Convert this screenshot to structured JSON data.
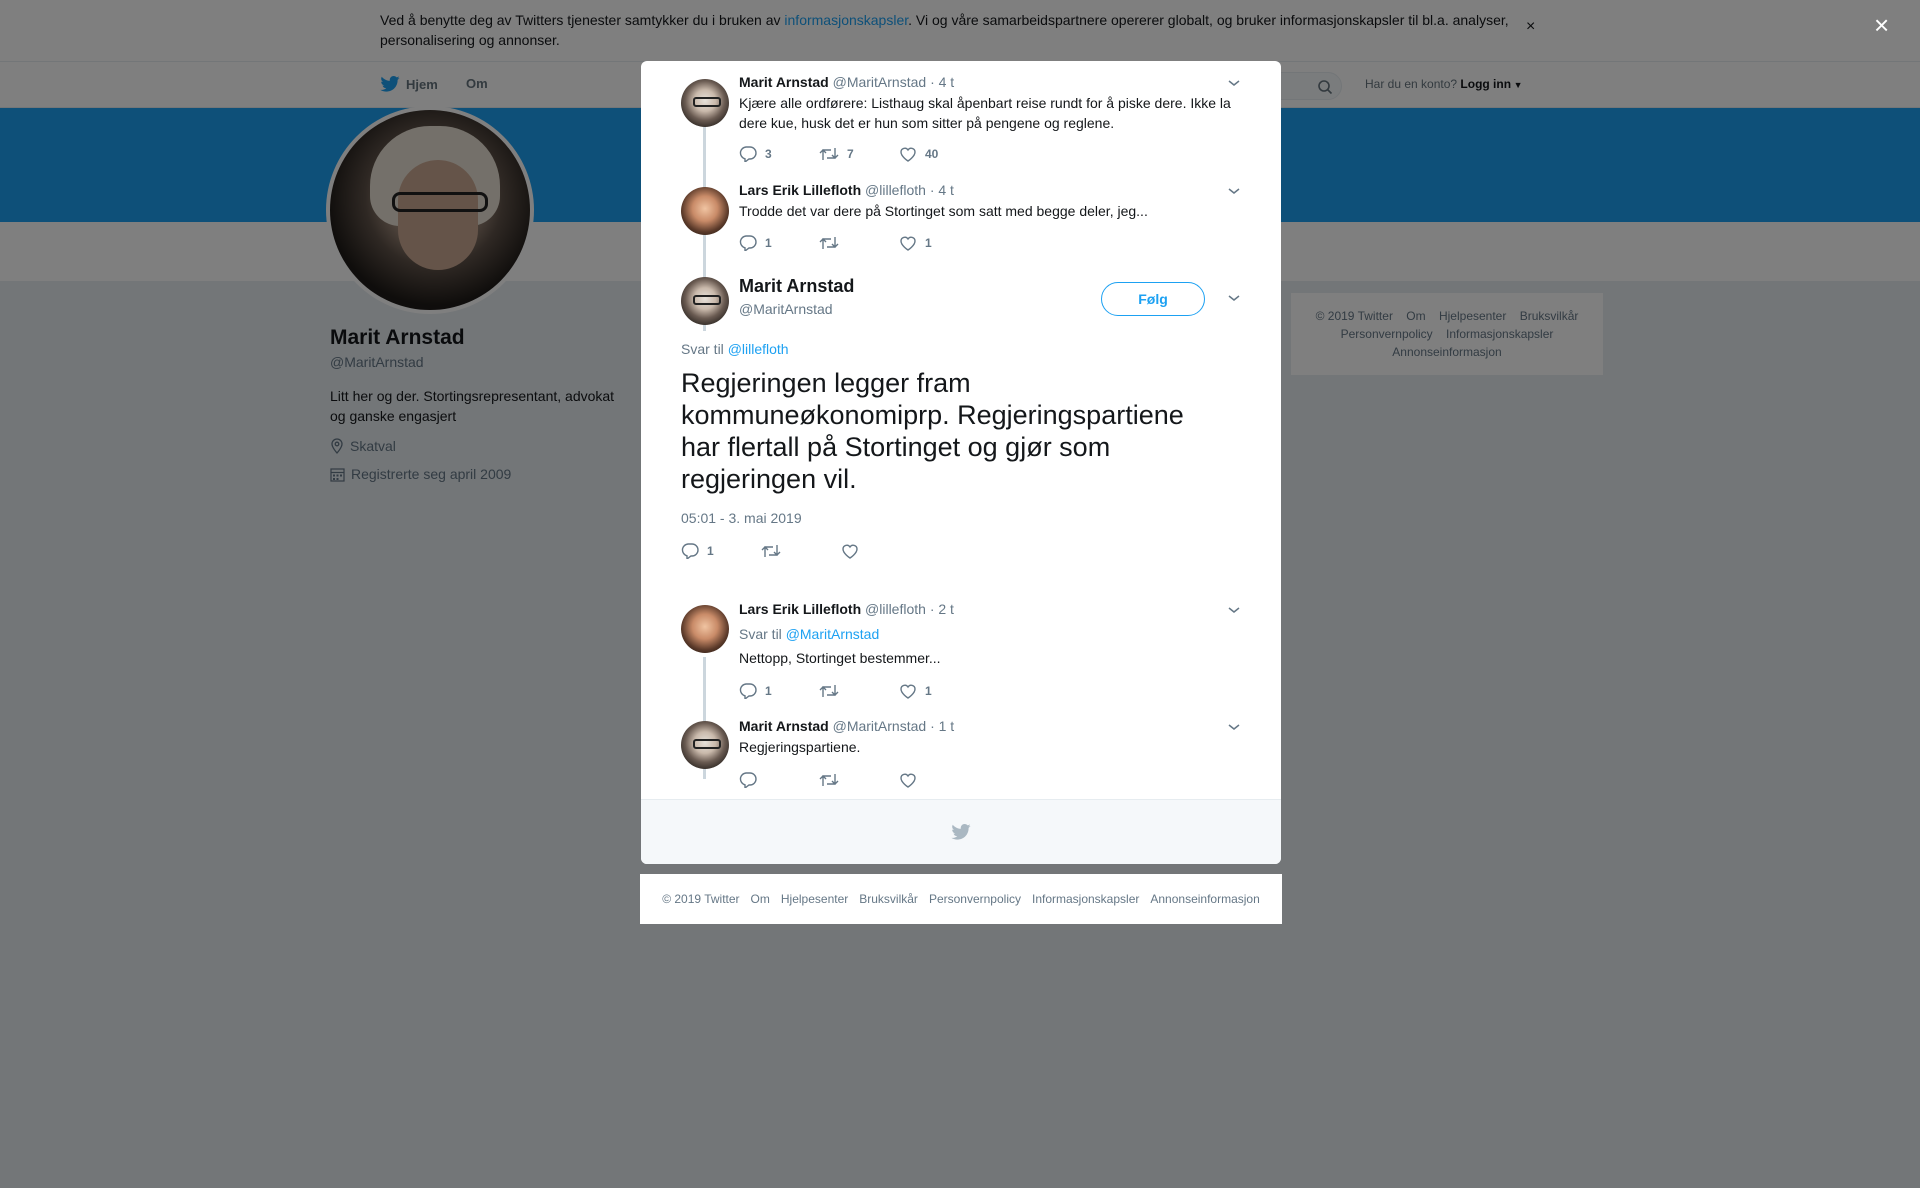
{
  "cookie": {
    "text_before": "Ved å benytte deg av Twitters tjenester samtykker du i bruken av ",
    "link": "informasjonskapsler",
    "text_after": ". Vi og våre samarbeidspartnere opererer globalt, og bruker informasjonskapsler til bl.a. analyser, personalisering og annonser.",
    "close": "×"
  },
  "nav": {
    "home": "Hjem",
    "about": "Om",
    "login_prompt": "Har du en konto?",
    "login": "Logg inn"
  },
  "profile": {
    "name": "Marit Arnstad",
    "handle": "@MaritArnstad",
    "bio": "Litt her og der. Stortingsrepresentant, advokat og ganske engasjert",
    "location": "Skatval",
    "joined": "Registrerte seg april 2009"
  },
  "side_footer": {
    "links": [
      "© 2019 Twitter",
      "Om",
      "Hjelpesenter",
      "Bruksvilkår",
      "Personvernpolicy",
      "Informasjonskapsler",
      "Annonseinformasjon"
    ]
  },
  "overlay": {
    "close": "×"
  },
  "tweets": [
    {
      "name": "Marit Arnstad",
      "handle": "@MaritArnstad",
      "time": "· 4 t",
      "text": "Kjære alle ordførere: Listhaug skal åpenbart reise rundt for å piske dere. Ikke la dere kue, husk det er hun som sitter på pengene og reglene.",
      "replies": "3",
      "retweets": "7",
      "likes": "40"
    },
    {
      "name": "Lars Erik Lillefloth",
      "handle": "@lillefloth",
      "time": "· 4 t",
      "text": "Trodde det var dere på Stortinget som satt med begge deler, jeg...",
      "replies": "1",
      "retweets": "",
      "likes": "1"
    }
  ],
  "main_tweet": {
    "name": "Marit Arnstad",
    "handle": "@MaritArnstad",
    "follow": "Følg",
    "reply_label": "Svar til",
    "reply_to": "@lillefloth",
    "text": "Regjeringen legger fram kommuneøkonomiprp. Regjeringspartiene har flertall på Stortinget og gjør som regjeringen vil.",
    "timestamp": "05:01 - 3. mai 2019",
    "replies": "1",
    "retweets": "",
    "likes": ""
  },
  "replies": [
    {
      "name": "Lars Erik Lillefloth",
      "handle": "@lillefloth",
      "time": "· 2 t",
      "reply_label": "Svar til",
      "reply_to": "@MaritArnstad",
      "text": "Nettopp, Stortinget bestemmer...",
      "replies": "1",
      "retweets": "",
      "likes": "1"
    },
    {
      "name": "Marit Arnstad",
      "handle": "@MaritArnstad",
      "time": "· 1 t",
      "text": "Regjeringspartiene.",
      "replies": "",
      "retweets": "",
      "likes": ""
    }
  ],
  "bottom_footer": {
    "links": [
      "© 2019 Twitter",
      "Om",
      "Hjelpesenter",
      "Bruksvilkår",
      "Personvernpolicy",
      "Informasjonskapsler",
      "Annonseinformasjon"
    ]
  },
  "colors": {
    "brand": "#1da1f2",
    "overlay": "rgba(0,0,0,0.5)"
  },
  "icons": [
    "twitter-bird-icon",
    "search-icon",
    "location-pin-icon",
    "calendar-icon",
    "reply-icon",
    "retweet-icon",
    "like-icon",
    "chevron-down-icon",
    "close-icon"
  ]
}
